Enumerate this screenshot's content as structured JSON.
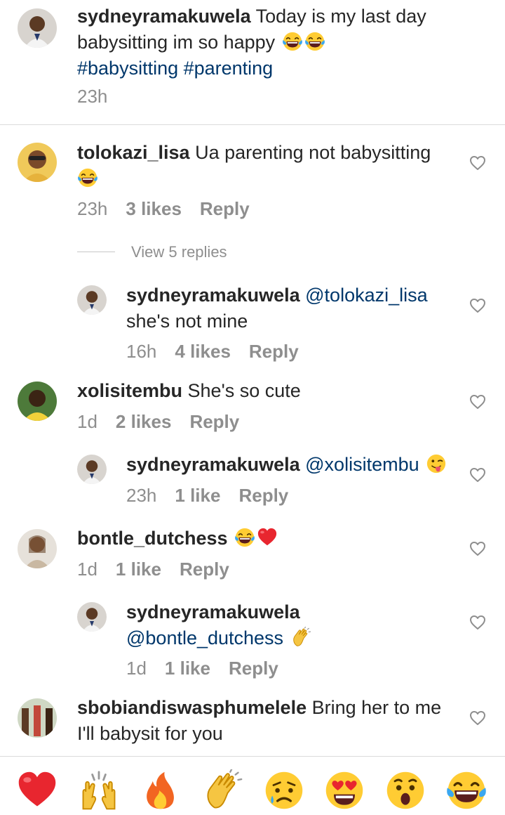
{
  "caption": {
    "username": "sydneyramakuwela",
    "text": " Today is my last day babysitting im so happy",
    "hashtags": "#babysitting #parenting",
    "time": "23h"
  },
  "comments": [
    {
      "username": "tolokazi_lisa",
      "text": " Ua parenting not babysitting",
      "time": "23h",
      "likes": "3 likes",
      "reply": "Reply"
    },
    {
      "username": "sydneyramakuwela",
      "mention": " @tolokazi_lisa",
      "text": "she's not mine",
      "time": "16h",
      "likes": "4 likes",
      "reply": "Reply"
    },
    {
      "username": "xolisitembu",
      "text": " She's so cute",
      "time": "1d",
      "likes": "2 likes",
      "reply": "Reply"
    },
    {
      "username": "sydneyramakuwela",
      "mention": " @xolisitembu",
      "time": "23h",
      "likes": "1 like",
      "reply": "Reply"
    },
    {
      "username": "bontle_dutchess",
      "time": "1d",
      "likes": "1 like",
      "reply": "Reply"
    },
    {
      "username": "sydneyramakuwela",
      "mention": "@bontle_dutchess",
      "time": "1d",
      "likes": "1 like",
      "reply": "Reply"
    },
    {
      "username": "sbobiandiswasphumelele",
      "text": " Bring her to me",
      "text2": "I'll babysit for you"
    }
  ],
  "view_replies": "View 5 replies",
  "emoji_bar": [
    "red-heart",
    "raising-hands",
    "fire",
    "clapping-hands",
    "crying-face",
    "heart-eyes",
    "surprised-face",
    "tears-of-joy"
  ],
  "colors": {
    "text": "#262626",
    "secondary": "#8e8e8e",
    "hashtag": "#00376b",
    "divider": "#dbdbdb",
    "heart": "#e0245e"
  }
}
